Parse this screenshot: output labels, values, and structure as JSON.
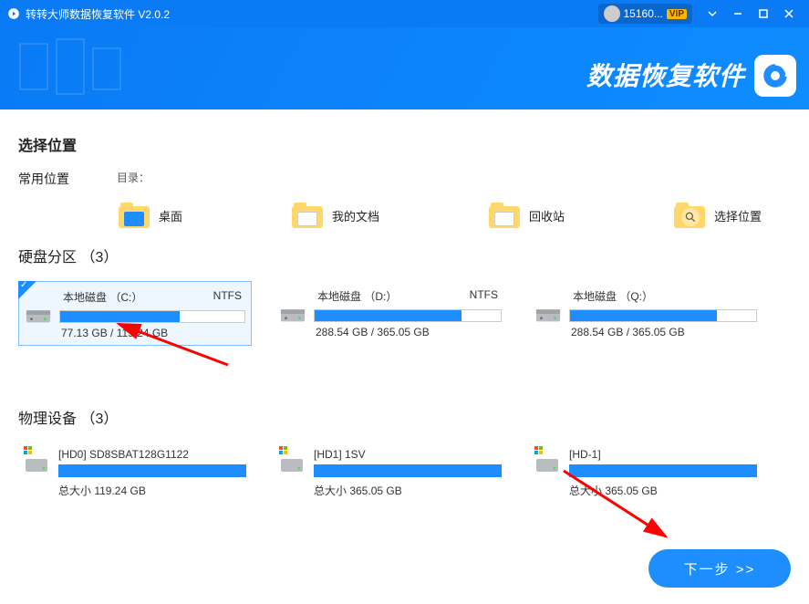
{
  "titlebar": {
    "app_name": "转转大师数据恢复软件 V2.0.2",
    "user_id": "15160...",
    "vip_badge": "VIP"
  },
  "banner": {
    "title": "数据恢复软件"
  },
  "sections": {
    "location_title": "选择位置",
    "common_label": "常用位置",
    "dir_label": "目录：",
    "partitions_title": "硬盘分区",
    "partitions_count": "（3）",
    "physical_title": "物理设备",
    "physical_count": "（3）"
  },
  "locations": {
    "desktop": "桌面",
    "documents": "我的文档",
    "recycle": "回收站",
    "choose": "选择位置"
  },
  "partitions": [
    {
      "name": "本地磁盘 （C:）",
      "fs": "NTFS",
      "used": 77.13,
      "total": 119.24,
      "size_text": "77.13 GB / 119.24 GB",
      "fill_pct": 64.7,
      "selected": true
    },
    {
      "name": "本地磁盘 （D:）",
      "fs": "NTFS",
      "used": 288.54,
      "total": 365.05,
      "size_text": "288.54 GB / 365.05 GB",
      "fill_pct": 79.0,
      "selected": false
    },
    {
      "name": "本地磁盘 （Q:）",
      "fs": "",
      "used": 288.54,
      "total": 365.05,
      "size_text": "288.54 GB / 365.05 GB",
      "fill_pct": 79.0,
      "selected": false
    }
  ],
  "physical": [
    {
      "name": "[HD0] SD8SBAT128G1122",
      "size_text": "总大小 119.24 GB"
    },
    {
      "name": "[HD1] 1SV",
      "size_text": "总大小 365.05 GB"
    },
    {
      "name": "[HD-1]",
      "size_text": "总大小 365.05 GB"
    }
  ],
  "next_button": "下一步 >>"
}
